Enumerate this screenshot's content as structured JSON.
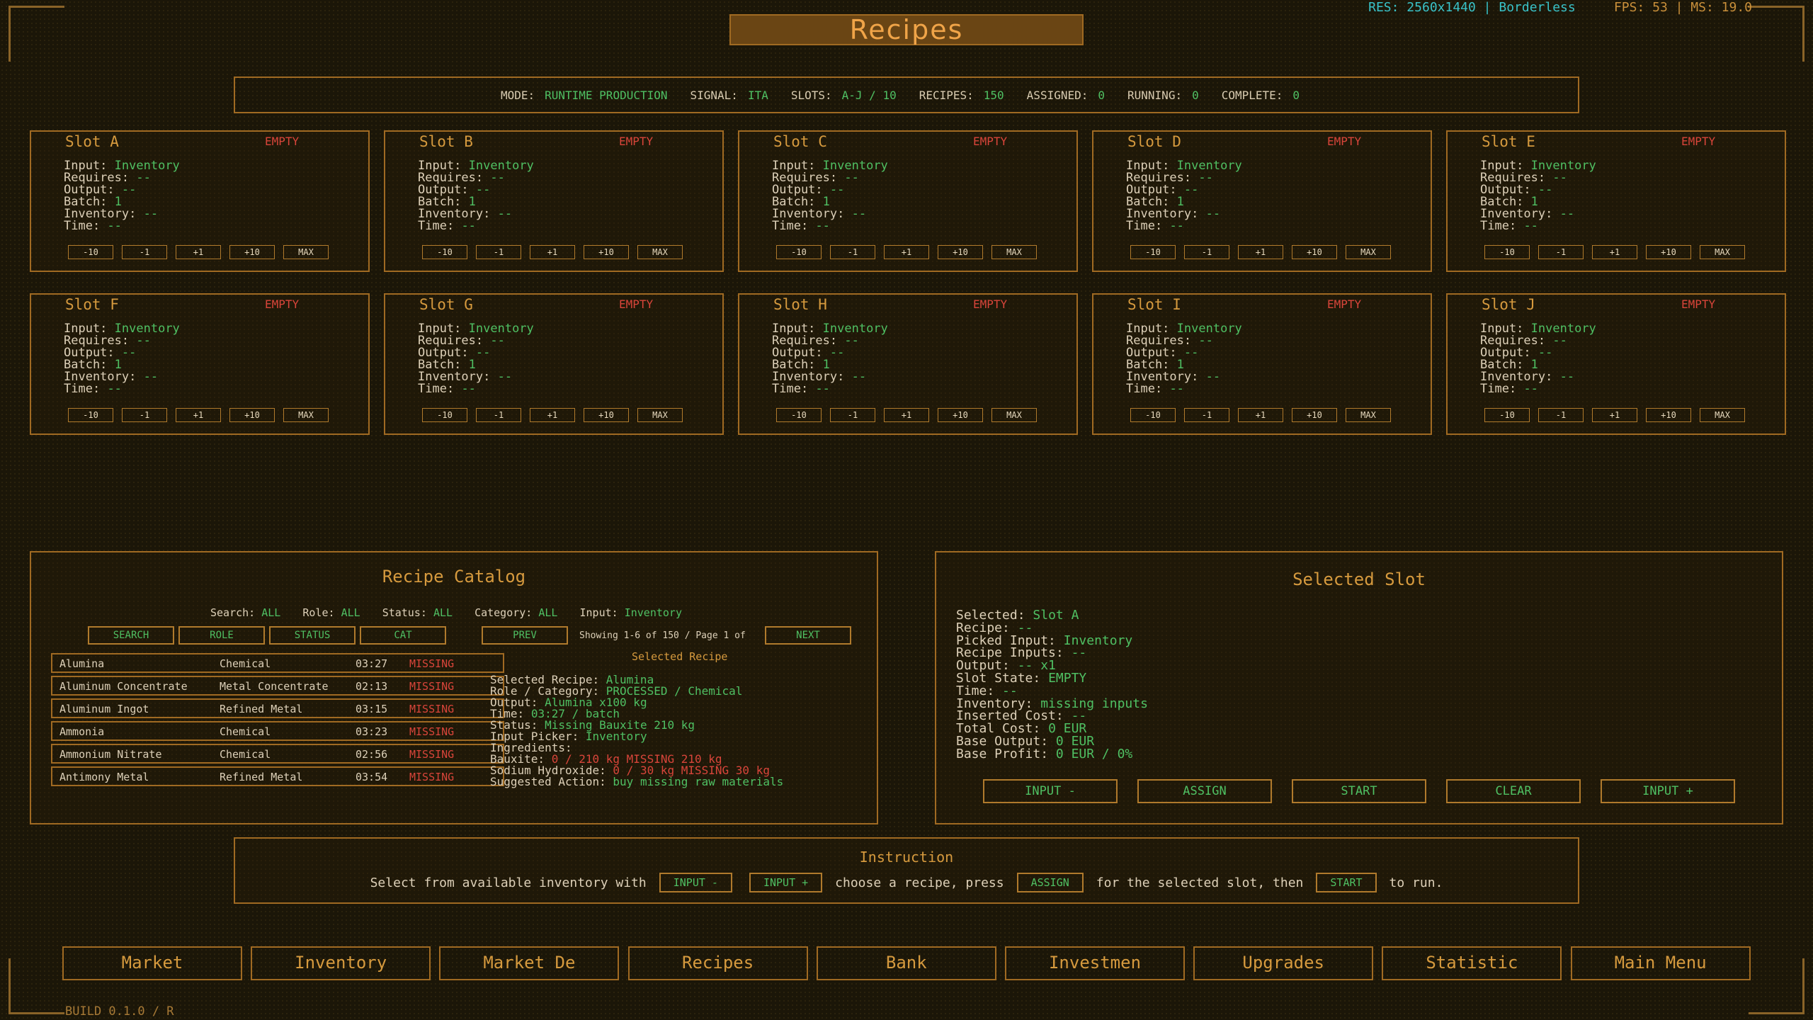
{
  "title": "Recipes",
  "topright": {
    "res": "RES: 2560x1440 | Borderless",
    "fps": "FPS: 53 | MS: 19.0"
  },
  "status": {
    "mode_k": "MODE:",
    "mode_v": "RUNTIME PRODUCTION",
    "signal_k": "SIGNAL:",
    "signal_v": "ITA",
    "slots_k": "SLOTS:",
    "slots_v": "A-J / 10",
    "recipes_k": "RECIPES:",
    "recipes_v": "150",
    "assigned_k": "ASSIGNED:",
    "assigned_v": "0",
    "running_k": "RUNNING:",
    "running_v": "0",
    "complete_k": "COMPLETE:",
    "complete_v": "0"
  },
  "slot_labels": {
    "input": "Input:",
    "requires": "Requires:",
    "output": "Output:",
    "batch": "Batch:",
    "inventory": "Inventory:",
    "time": "Time:",
    "input_v": "Inventory",
    "dash": "--",
    "batch_v": "1",
    "state": "EMPTY",
    "b1": "-10",
    "b2": "-1",
    "b3": "+1",
    "b4": "+10",
    "b5": "MAX"
  },
  "slots": [
    {
      "name": "Slot A"
    },
    {
      "name": "Slot B"
    },
    {
      "name": "Slot C"
    },
    {
      "name": "Slot D"
    },
    {
      "name": "Slot E"
    },
    {
      "name": "Slot F"
    },
    {
      "name": "Slot G"
    },
    {
      "name": "Slot H"
    },
    {
      "name": "Slot I"
    },
    {
      "name": "Slot J"
    }
  ],
  "catalog": {
    "title": "Recipe Catalog",
    "search_k": "Search:",
    "search_v": "ALL",
    "role_k": "Role:",
    "role_v": "ALL",
    "status_k": "Status:",
    "status_v": "ALL",
    "category_k": "Category:",
    "category_v": "ALL",
    "input_k": "Input:",
    "input_v": "Inventory",
    "btn_search": "SEARCH",
    "btn_role": "ROLE",
    "btn_status": "STATUS",
    "btn_cat": "CAT",
    "btn_prev": "PREV",
    "btn_next": "NEXT",
    "showing": "Showing 1-6 of 150 / Page 1 of",
    "selected_header": "Selected Recipe",
    "rows": [
      {
        "name": "Alumina",
        "category": "Chemical",
        "time": "03:27",
        "status": "MISSING"
      },
      {
        "name": "Aluminum Concentrate",
        "category": "Metal Concentrate",
        "time": "02:13",
        "status": "MISSING"
      },
      {
        "name": "Aluminum Ingot",
        "category": "Refined Metal",
        "time": "03:15",
        "status": "MISSING"
      },
      {
        "name": "Ammonia",
        "category": "Chemical",
        "time": "03:23",
        "status": "MISSING"
      },
      {
        "name": "Ammonium Nitrate",
        "category": "Chemical",
        "time": "02:56",
        "status": "MISSING"
      },
      {
        "name": "Antimony Metal",
        "category": "Refined Metal",
        "time": "03:54",
        "status": "MISSING"
      }
    ],
    "detail": {
      "sel_k": "Selected Recipe:",
      "sel_v": "Alumina",
      "role_k": "Role / Category:",
      "role_v": "PROCESSED / Chemical",
      "out_k": "Output:",
      "out_v": "Alumina x100 kg",
      "time_k": "Time:",
      "time_v": "03:27 / batch",
      "status_k": "Status:",
      "status_v": "Missing Bauxite 210 kg",
      "picker_k": "Input Picker:",
      "picker_v": "Inventory",
      "ingr_k": "Ingredients:",
      "baux_k": "Bauxite:",
      "baux_v": "0 / 210 kg MISSING 210 kg",
      "sodium_k": "Sodium Hydroxide:",
      "sodium_v": "0 / 30 kg MISSING 30 kg",
      "action_k": "Suggested Action:",
      "action_v": "buy missing raw materials"
    }
  },
  "selected": {
    "title": "Selected Slot",
    "selected_k": "Selected:",
    "selected_v": "Slot A",
    "recipe_k": "Recipe:",
    "recipe_v": "--",
    "picked_k": "Picked Input:",
    "picked_v": "Inventory",
    "rinputs_k": "Recipe Inputs:",
    "rinputs_v": "--",
    "output_k": "Output:",
    "output_v": "-- x1",
    "state_k": "Slot State:",
    "state_v": "EMPTY",
    "time_k": "Time:",
    "time_v": "--",
    "inv_k": "Inventory:",
    "inv_v": "missing inputs",
    "ins_k": "Inserted Cost:",
    "ins_v": "--",
    "tcost_k": "Total Cost:",
    "tcost_v": "0 EUR",
    "bout_k": "Base Output:",
    "bout_v": "0 EUR",
    "bprof_k": "Base Profit:",
    "bprof_v": "0 EUR / 0%",
    "btn_input_minus": "INPUT -",
    "btn_assign": "ASSIGN",
    "btn_start": "START",
    "btn_clear": "CLEAR",
    "btn_input_plus": "INPUT +"
  },
  "instruction": {
    "title": "Instruction",
    "t1": "Select from available inventory with",
    "b1": "INPUT -",
    "b2": "INPUT +",
    "t2": "choose a recipe, press",
    "b3": "ASSIGN",
    "t3": "for the selected slot, then",
    "b4": "START",
    "t4": "to run."
  },
  "nav": [
    "Market",
    "Inventory",
    "Market De",
    "Recipes",
    "Bank",
    "Investmen",
    "Upgrades",
    "Statistic",
    "Main Menu"
  ],
  "build": "BUILD 0.1.0 / R"
}
